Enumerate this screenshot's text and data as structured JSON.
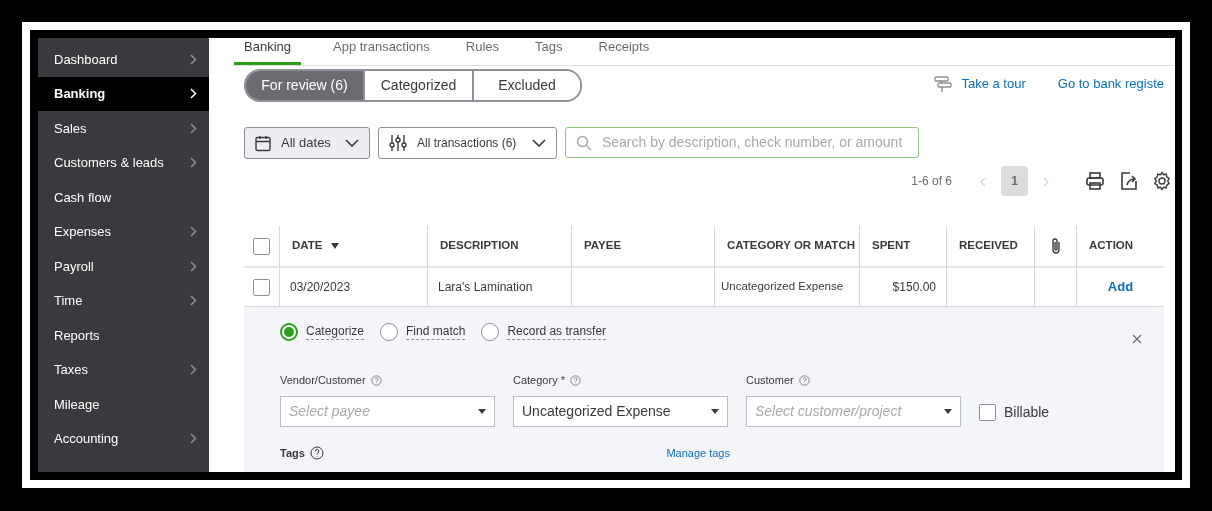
{
  "sidebar": {
    "items": [
      {
        "label": "Dashboard",
        "chevron": true,
        "selected": false
      },
      {
        "label": "Banking",
        "chevron": true,
        "selected": true
      },
      {
        "label": "Sales",
        "chevron": true,
        "selected": false
      },
      {
        "label": "Customers & leads",
        "chevron": true,
        "selected": false
      },
      {
        "label": "Cash flow",
        "chevron": false,
        "selected": false
      },
      {
        "label": "Expenses",
        "chevron": true,
        "selected": false
      },
      {
        "label": "Payroll",
        "chevron": true,
        "selected": false
      },
      {
        "label": "Time",
        "chevron": true,
        "selected": false
      },
      {
        "label": "Reports",
        "chevron": false,
        "selected": false
      },
      {
        "label": "Taxes",
        "chevron": true,
        "selected": false
      },
      {
        "label": "Mileage",
        "chevron": false,
        "selected": false
      },
      {
        "label": "Accounting",
        "chevron": true,
        "selected": false
      }
    ]
  },
  "tabs": [
    {
      "label": "Banking",
      "selected": true
    },
    {
      "label": "App transactions",
      "selected": false
    },
    {
      "label": "Rules",
      "selected": false
    },
    {
      "label": "Tags",
      "selected": false
    },
    {
      "label": "Receipts",
      "selected": false
    }
  ],
  "segments": [
    {
      "label": "For review (6)",
      "selected": true
    },
    {
      "label": "Categorized",
      "selected": false
    },
    {
      "label": "Excluded",
      "selected": false
    }
  ],
  "links": {
    "tour": "Take a tour",
    "register": "Go to bank registe"
  },
  "filters": {
    "dates": "All dates",
    "transactions": "All transactions (6)",
    "search": {
      "placeholder": "Search by description, check number, or amount"
    }
  },
  "pagination": {
    "range": "1-6 of 6",
    "page": "1"
  },
  "table": {
    "select_all": {
      "checked": false
    },
    "columns": [
      {
        "kind": "check"
      },
      {
        "kind": "text",
        "label": "DATE",
        "sorted": true
      },
      {
        "kind": "text",
        "label": "DESCRIPTION"
      },
      {
        "kind": "text",
        "label": "PAYEE"
      },
      {
        "kind": "text",
        "label": "CATEGORY OR MATCH"
      },
      {
        "kind": "text",
        "label": "SPENT"
      },
      {
        "kind": "text",
        "label": "RECEIVED"
      },
      {
        "kind": "attachment"
      },
      {
        "kind": "text",
        "label": "ACTION"
      }
    ],
    "rows": [
      {
        "checked": false,
        "date": "03/20/2023",
        "description": "Lara's Lamination",
        "category": "Uncategorized Expense",
        "spent": "$150.00",
        "action": "Add"
      }
    ]
  },
  "detail": {
    "modes": [
      {
        "label": "Categorize",
        "selected": true
      },
      {
        "label": "Find match",
        "selected": false
      },
      {
        "label": "Record as transfer",
        "selected": false
      }
    ],
    "fields": [
      {
        "label": "Vendor/Customer",
        "placeholder": "Select payee"
      },
      {
        "label": "Category *",
        "value": "Uncategorized Expense"
      },
      {
        "label": "Customer",
        "placeholder": "Select customer/project"
      }
    ],
    "billable": {
      "label": "Billable",
      "checked": false
    },
    "tags": "Tags",
    "manage_tags": "Manage tags"
  }
}
